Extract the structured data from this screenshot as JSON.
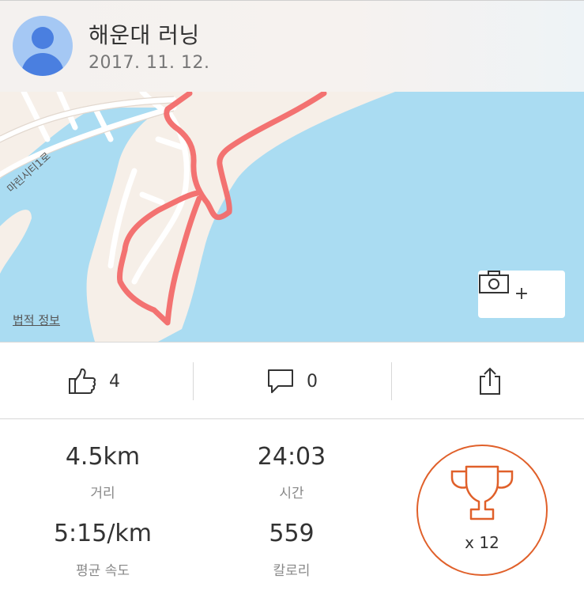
{
  "header": {
    "title": "해운대 러닝",
    "date": "2017. 11. 12."
  },
  "map": {
    "legal_link": "법적 정보",
    "street_label": "마린시티1로",
    "photo_add_plus": "+"
  },
  "actions": {
    "likes": "4",
    "comments": "0"
  },
  "stats": {
    "distance": {
      "value": "4.5km",
      "label": "거리"
    },
    "time": {
      "value": "24:03",
      "label": "시간"
    },
    "pace": {
      "value": "5:15/km",
      "label": "평균 속도"
    },
    "calories": {
      "value": "559",
      "label": "칼로리"
    }
  },
  "achievements": {
    "count": "x 12"
  },
  "colors": {
    "route": "#f26a6a",
    "water": "#aadcf2",
    "land": "#f6efe8",
    "accent": "#e0602a"
  }
}
